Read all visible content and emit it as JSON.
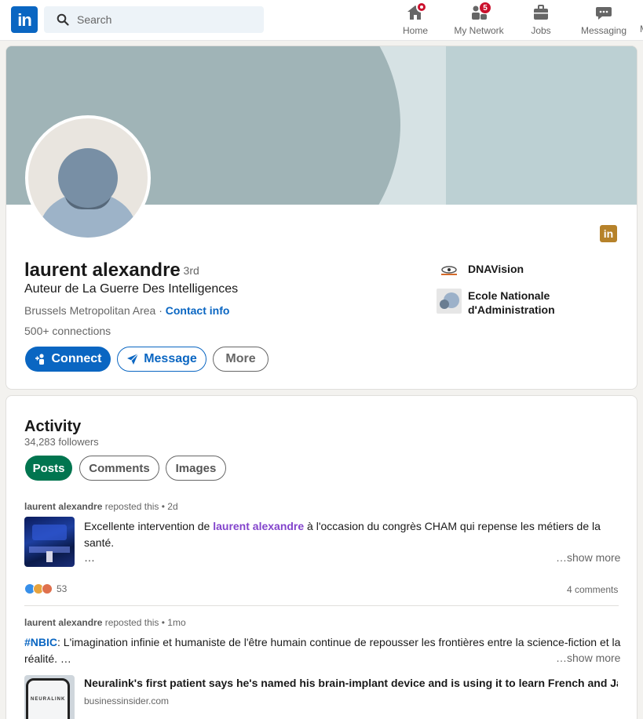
{
  "nav": {
    "search_placeholder": "Search",
    "items": [
      {
        "label": "Home",
        "icon": "home-icon",
        "badge": ""
      },
      {
        "label": "My Network",
        "icon": "network-icon",
        "badge": "5"
      },
      {
        "label": "Jobs",
        "icon": "briefcase-icon",
        "badge": ""
      },
      {
        "label": "Messaging",
        "icon": "messaging-icon",
        "badge": ""
      }
    ],
    "overflow_glyph": "M"
  },
  "profile": {
    "name": "laurent alexandre",
    "degree": "· 3rd",
    "headline": "Auteur de La Guerre Des Intelligences",
    "location": "Brussels Metropolitan Area",
    "location_sep": " · ",
    "contact_label": "Contact info",
    "connections": "500+ connections",
    "buttons": {
      "connect": "Connect",
      "message": "Message",
      "more": "More"
    },
    "experience": [
      {
        "name": "DNAVision"
      },
      {
        "name": "Ecole Nationale d'Administration"
      }
    ]
  },
  "activity": {
    "title": "Activity",
    "followers": "34,283 followers",
    "tabs": [
      "Posts",
      "Comments",
      "Images"
    ],
    "posts": [
      {
        "author": "laurent alexandre",
        "action": " reposted this • 2d",
        "text_before": "Excellente intervention de ",
        "mention": "laurent alexandre",
        "text_after": " à l'occasion du congrès CHAM qui repense les métiers de la santé.",
        "ellipsis": "…",
        "show_more": "…show more",
        "reactions": "53",
        "comments": "4 comments"
      },
      {
        "author": "laurent alexandre",
        "action": " reposted this • 1mo",
        "hashtag": "#NBIC",
        "text": ": L'imagination infinie et humaniste de l'être humain continue de repousser les frontières entre la science-fiction et la réalité. …",
        "show_more": "…show more",
        "link_title": "Neuralink's first patient says he's named his brain-implant device and is using it to learn French and Japa…",
        "link_source": "businessinsider.com",
        "thumb_text": "NEURALINK"
      }
    ]
  },
  "colors": {
    "brand": "#0a66c2",
    "posts_pill": "#01754f",
    "badge": "#cb112d"
  }
}
